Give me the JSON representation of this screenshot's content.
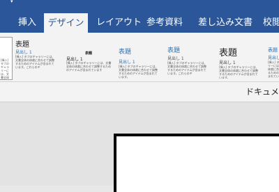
{
  "ribbon": {
    "tabs": [
      {
        "label": "挿入",
        "active": false
      },
      {
        "label": "デザイン",
        "active": true
      },
      {
        "label": "レイアウト",
        "active": false
      },
      {
        "label": "参考資料",
        "active": false
      },
      {
        "label": "差し込み文書",
        "active": false
      },
      {
        "label": "校閲",
        "active": false
      }
    ]
  },
  "style_gallery": {
    "items": [
      {
        "title": "",
        "heading": "",
        "body": "[挿入] タブのギャラリーには、文書全体の体裁に合わせて調整するためのアイテムが含まれています。"
      },
      {
        "title": "表題",
        "heading": "見出し 1",
        "body": "[挿入] タブのギャラリーには、文書全体の体裁に合わせて調整するためのアイテムが含まれています。これらのギ"
      },
      {
        "title": "表題",
        "heading": "見出し 1",
        "body": "[挿入] タブのギャラリーには、文書全体の体裁に合わせて調整するためのアイテムが含まれています"
      },
      {
        "title": "表題",
        "heading": "見出し 1",
        "body": "[挿入] タブのギャラリーには、文書全体の体裁に合わせて調整するためのアイテムが含まれています。"
      },
      {
        "title": "表題",
        "heading": "見出し 1",
        "body": "[挿入] タブのギャラリーには、文書全体の体裁に合わせて調整するためのアイテムが含まれています。これらのギ"
      },
      {
        "title": "表題",
        "heading": "見出し 1",
        "body": "[挿入] タブのギャラリーには、文書全体の体裁に合わせて調整するためのアイテムが含まれています。"
      },
      {
        "title": "表題",
        "heading": "見出し 1",
        "body": "[挿入] タブのギャラリーには、文書全体の体裁に合わせて調整するためのアイテムが含まれています。"
      }
    ]
  },
  "document": {
    "title": "ドキュメ"
  },
  "colors": {
    "ribbon_blue": "#2b579a",
    "gallery_bg": "#f3f3f3",
    "accent_heading": "#2e74b5"
  }
}
